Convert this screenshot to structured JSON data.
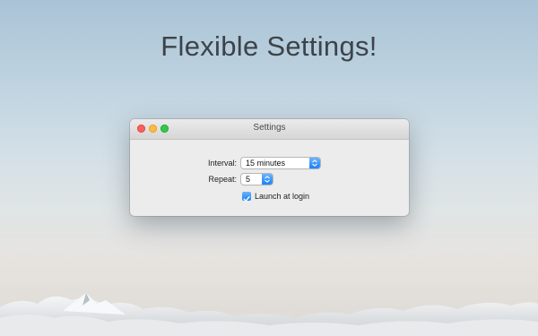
{
  "hero": {
    "title": "Flexible Settings!"
  },
  "window": {
    "title": "Settings",
    "traffic_lights": {
      "close_color": "#fc605c",
      "minimize_color": "#fdbc40",
      "zoom_color": "#34c84a"
    },
    "interval": {
      "label": "Interval:",
      "value": "15 minutes",
      "icon": "chevron-up-down-icon"
    },
    "repeat": {
      "label": "Repeat:",
      "value": "5",
      "icon": "chevron-up-down-icon"
    },
    "launch_at_login": {
      "label": "Launch at login",
      "checked": true,
      "icon": "checkmark-icon"
    }
  },
  "colors": {
    "accent": "#1a82fb"
  }
}
